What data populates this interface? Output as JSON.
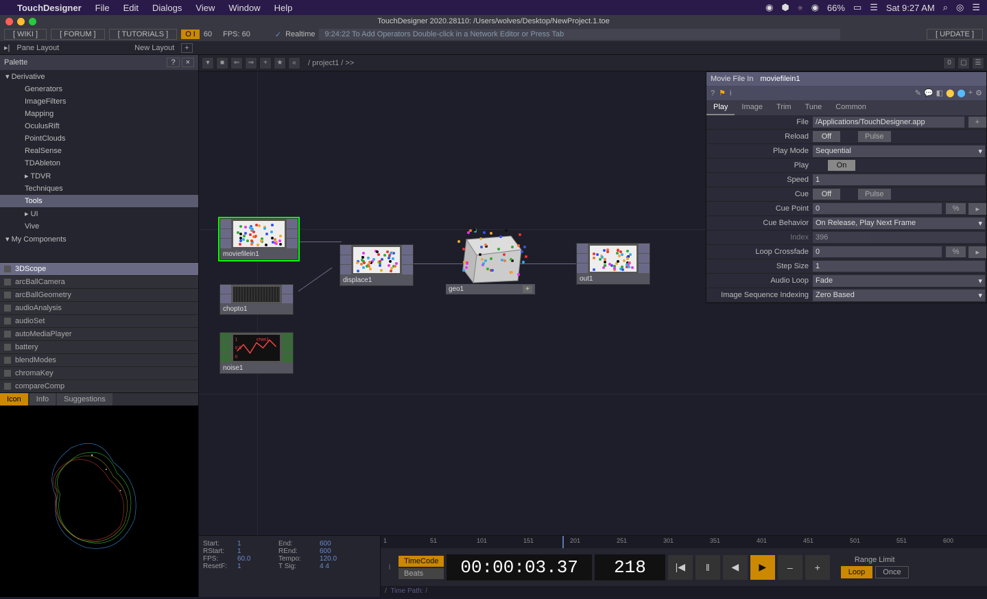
{
  "menubar": {
    "app": "TouchDesigner",
    "items": [
      "File",
      "Edit",
      "Dialogs",
      "View",
      "Window",
      "Help"
    ],
    "battery": "66%",
    "clock": "Sat 9:27 AM"
  },
  "titlebar": "TouchDesigner 2020.28110: /Users/wolves/Desktop/NewProject.1.toe",
  "toolbar1": {
    "links": [
      "[ WIKI ]",
      "[ FORUM ]",
      "[ TUTORIALS ]"
    ],
    "oi": "O I",
    "oi_val": "60",
    "fps": "FPS:  60",
    "rt_check": "✓",
    "realtime": "Realtime",
    "hint": "9:24:22 To Add Operators Double-click in a Network Editor or Press Tab",
    "update": "[ UPDATE ]"
  },
  "toolbar2": {
    "pane": "Pane Layout",
    "new": "New Layout",
    "plus": "+"
  },
  "palette": {
    "title": "Palette",
    "tree": [
      {
        "label": "Derivative",
        "type": "hdr"
      },
      {
        "label": "Generators",
        "type": "indent"
      },
      {
        "label": "ImageFilters",
        "type": "indent"
      },
      {
        "label": "Mapping",
        "type": "indent"
      },
      {
        "label": "OculusRift",
        "type": "indent"
      },
      {
        "label": "PointClouds",
        "type": "indent"
      },
      {
        "label": "RealSense",
        "type": "indent"
      },
      {
        "label": "TDAbleton",
        "type": "indent"
      },
      {
        "label": "TDVR",
        "type": "indent"
      },
      {
        "label": "Techniques",
        "type": "indent"
      },
      {
        "label": "Tools",
        "type": "indent sel"
      },
      {
        "label": "UI",
        "type": "indent"
      },
      {
        "label": "Vive",
        "type": "indent"
      },
      {
        "label": "My Components",
        "type": "hdr"
      }
    ],
    "components": [
      {
        "label": "3DScope",
        "sel": true
      },
      {
        "label": "arcBallCamera"
      },
      {
        "label": "arcBallGeometry"
      },
      {
        "label": "audioAnalysis"
      },
      {
        "label": "audioSet"
      },
      {
        "label": "autoMediaPlayer"
      },
      {
        "label": "battery"
      },
      {
        "label": "blendModes"
      },
      {
        "label": "chromaKey"
      },
      {
        "label": "compareComp"
      }
    ],
    "preview_tabs": [
      "Icon",
      "Info",
      "Suggestions"
    ]
  },
  "network": {
    "path": "/ project1 / >>",
    "nodes": {
      "moviefilein1": "moviefilein1",
      "chopto1": "chopto1",
      "noise1": "noise1",
      "displace1": "displace1",
      "geo1": "geo1",
      "out1": "out1"
    }
  },
  "params": {
    "type": "Movie File In",
    "name": "moviefilein1",
    "tabs": [
      "Play",
      "Image",
      "Trim",
      "Tune",
      "Common"
    ],
    "rows": [
      {
        "label": "File",
        "val": "/Applications/TouchDesigner.app",
        "kind": "text"
      },
      {
        "label": "Reload",
        "val": "Off",
        "btn": "Pulse",
        "kind": "toggle"
      },
      {
        "label": "Play Mode",
        "val": "Sequential",
        "kind": "drop"
      },
      {
        "label": "Play",
        "val": "On",
        "kind": "toggleOn"
      },
      {
        "label": "Speed",
        "val": "1",
        "kind": "num"
      },
      {
        "label": "Cue",
        "val": "Off",
        "btn": "Pulse",
        "kind": "toggle"
      },
      {
        "label": "Cue Point",
        "val": "0",
        "kind": "num",
        "suffix": "%"
      },
      {
        "label": "Cue Behavior",
        "val": "On Release, Play Next Frame",
        "kind": "drop"
      },
      {
        "label": "Index",
        "val": "396",
        "kind": "num",
        "dis": true
      },
      {
        "label": "Loop Crossfade",
        "val": "0",
        "kind": "num",
        "suffix": "%"
      },
      {
        "label": "Step Size",
        "val": "1",
        "kind": "num"
      },
      {
        "label": "Audio Loop",
        "val": "Fade",
        "kind": "drop"
      },
      {
        "label": "Image Sequence Indexing",
        "val": "Zero Based",
        "kind": "drop"
      }
    ]
  },
  "timeline": {
    "stats": [
      [
        "Start:",
        "1",
        "End:",
        "600"
      ],
      [
        "RStart:",
        "1",
        "REnd:",
        "600"
      ],
      [
        "FPS:",
        "60.0",
        "Tempo:",
        "120.0"
      ],
      [
        "ResetF:",
        "1",
        "T Sig:",
        "4     4"
      ]
    ],
    "ruler": [
      "1",
      "51",
      "101",
      "151",
      "201",
      "251",
      "301",
      "351",
      "401",
      "451",
      "501",
      "551",
      "600"
    ],
    "modes": [
      "TimeCode",
      "Beats"
    ],
    "time": "00:00:03.37",
    "frame": "218",
    "range_label": "Range Limit",
    "range_btns": [
      "Loop",
      "Once"
    ],
    "path": "Time Path: /"
  }
}
